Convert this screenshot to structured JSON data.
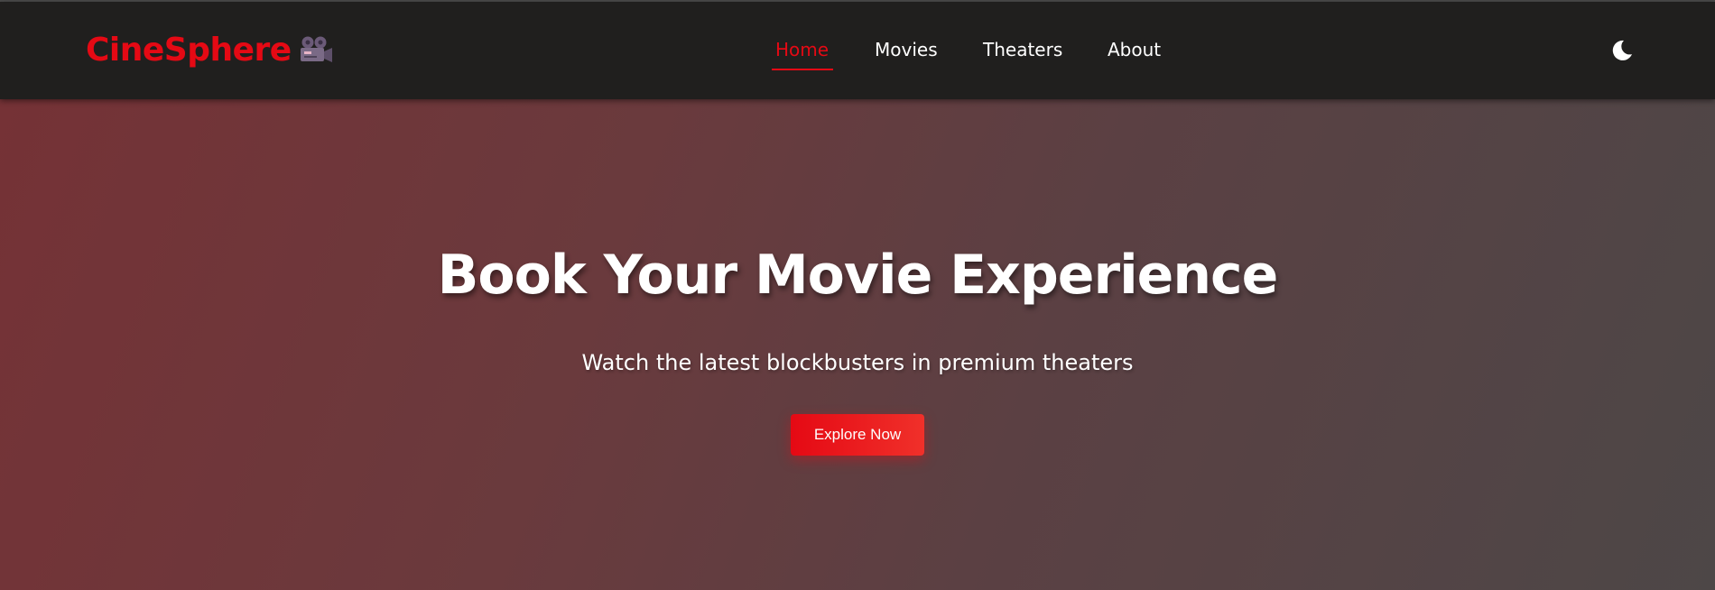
{
  "brand": {
    "name": "CineSphere",
    "icon": "movie-camera-icon",
    "color": "#e50914"
  },
  "nav": {
    "links": [
      {
        "label": "Home",
        "active": true
      },
      {
        "label": "Movies",
        "active": false
      },
      {
        "label": "Theaters",
        "active": false
      },
      {
        "label": "About",
        "active": false
      }
    ],
    "theme_toggle_icon": "moon-icon"
  },
  "hero": {
    "title": "Book Your Movie Experience",
    "subtitle": "Watch the latest blockbusters in premium theaters",
    "cta_label": "Explore Now"
  },
  "colors": {
    "accent": "#e50914",
    "navbar_bg": "#201f1e"
  }
}
